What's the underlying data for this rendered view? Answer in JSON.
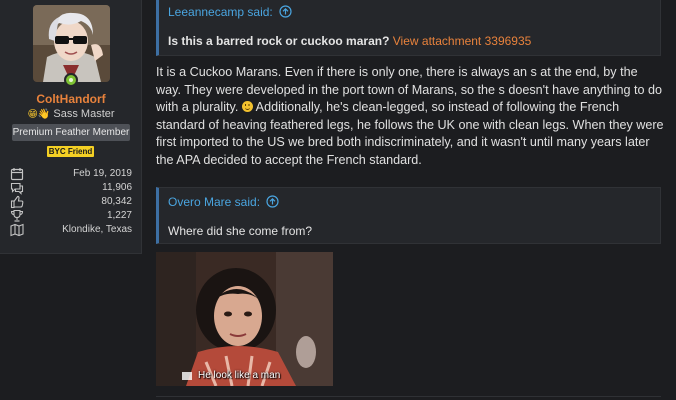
{
  "user": {
    "username": "ColtHandorf",
    "title": "Sass Master",
    "title_emoji": "😁👋",
    "badge": "Premium Feather Member",
    "friend_badge": "BYC Friend",
    "stats": [
      {
        "icon": "calendar-icon",
        "value": "Feb 19, 2019"
      },
      {
        "icon": "messages-icon",
        "value": "11,906"
      },
      {
        "icon": "thumbs-up-icon",
        "value": "80,342"
      },
      {
        "icon": "trophy-icon",
        "value": "1,227"
      },
      {
        "icon": "map-icon",
        "value": "Klondike, Texas"
      }
    ]
  },
  "quote1": {
    "author": "Leeannecamp said:",
    "text": "Is this a barred rock or cuckoo maran?",
    "attachment": "View attachment 3396935"
  },
  "post": {
    "part1": "It is a Cuckoo Marans. Even if there is only one, there is always an s at the end, by the way. They were developed in the port town of Marans, so the s doesn't have anything to do with a plurality.",
    "part2": " Additionally, he's clean-legged, so instead of following the French standard of heaving feathered legs, he follows the UK one with clean legs. When they were first imported to the US we bred both indiscriminately, and it wasn't until many years later the APA decided to accept the French standard."
  },
  "quote2": {
    "author": "Overo Mare said:",
    "text": "Where did she come from?"
  },
  "gif": {
    "caption": "He look like a man"
  },
  "colors": {
    "accent_orange": "#e8823c",
    "quote_link_blue": "#4aa5e0",
    "background": "#1c1d20",
    "panel": "#25272b"
  }
}
